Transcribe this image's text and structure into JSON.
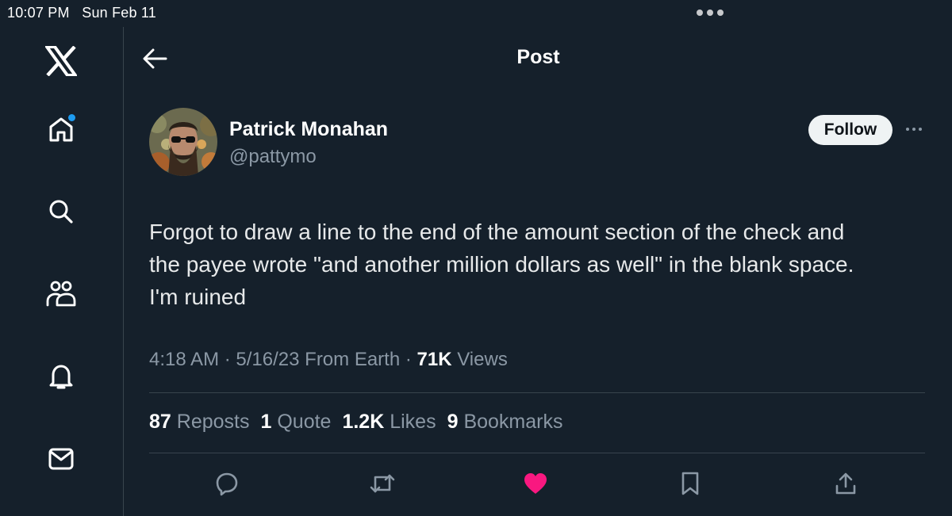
{
  "status_bar": {
    "time": "10:07 PM",
    "date": "Sun Feb 11"
  },
  "sidebar": {
    "items": [
      {
        "name": "x-logo-icon"
      },
      {
        "name": "home-icon"
      },
      {
        "name": "search-icon"
      },
      {
        "name": "communities-icon"
      },
      {
        "name": "notifications-icon"
      },
      {
        "name": "messages-icon"
      }
    ]
  },
  "header": {
    "title": "Post"
  },
  "post": {
    "author_name": "Patrick Monahan",
    "author_handle": "@pattymo",
    "follow_label": "Follow",
    "text": "Forgot to draw a line to the end of the amount section of the check and\nthe payee wrote \"and another million dollars as well\" in the blank space.\nI'm ruined",
    "meta": {
      "time": "4:18 AM",
      "separator": "·",
      "date": "5/16/23",
      "source": "From Earth",
      "views_count": "71K",
      "views_label": "Views"
    },
    "stats": {
      "reposts_count": "87",
      "reposts_label": "Reposts",
      "quotes_count": "1",
      "quotes_label": "Quote",
      "likes_count": "1.2K",
      "likes_label": "Likes",
      "bookmarks_count": "9",
      "bookmarks_label": "Bookmarks"
    },
    "liked": true
  },
  "colors": {
    "background": "#15202b",
    "accent": "#1d9bf0",
    "like": "#f91880",
    "secondary_text": "#8b98a5"
  }
}
